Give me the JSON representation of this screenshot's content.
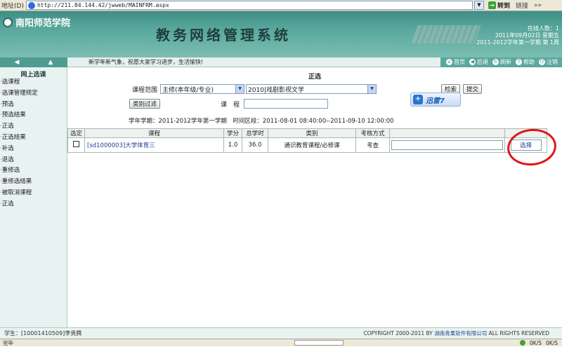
{
  "browser": {
    "address_label": "地址(D)",
    "url": "http://211.84.144.42/jwweb/MAINFRM.aspx",
    "go_label": "转到",
    "links_label": "链接",
    "more_label": "»»",
    "status_left": "完毕",
    "speed1": "0K/S",
    "speed2": "0K/S"
  },
  "header": {
    "school": "南阳师范学院",
    "system_title": "教务网络管理系统",
    "online_label": "在线人数：",
    "online_count": "1",
    "date_line": "2011年09月02日 星期五",
    "term_line": "2011-2012学年第一学期 第 1周"
  },
  "toolbar": {
    "motto": "新学年新气象，祝愿大家学习进步，生活愉快!",
    "links": [
      {
        "label": "首页",
        "icon": "home-icon",
        "glyph": "⌂"
      },
      {
        "label": "后退",
        "icon": "back-icon",
        "glyph": "◀"
      },
      {
        "label": "刷新",
        "icon": "refresh-icon",
        "glyph": "↻"
      },
      {
        "label": "帮助",
        "icon": "help-icon",
        "glyph": "?"
      },
      {
        "label": "注销",
        "icon": "logout-icon",
        "glyph": "⏻"
      }
    ]
  },
  "sidebar": {
    "title": "网上选课",
    "items": [
      "选课程",
      "选课管理规定",
      "预选",
      "预选结果",
      "正选",
      "正选结果",
      "补选",
      "退选",
      "重修选",
      "重修选结果",
      "被取消课程",
      "正选"
    ]
  },
  "main": {
    "title": "正选",
    "scope_label": "课程范围",
    "scope_value": "主修(本年级/专业)",
    "major_value": "2010|戏剧影视文学",
    "search_button": "检索",
    "submit_button": "提交",
    "filter_button": "类别过滤",
    "course_label": "课　程",
    "course_value": "",
    "xunlei_label": "迅雷7",
    "term_info": "学年学期：2011-2012学年第一学期　时间区段：2011-08-01 08:40:00--2011-09-10 12:00:00",
    "table": {
      "headers": [
        "选定",
        "课程",
        "学分",
        "总学时",
        "类别",
        "考核方式",
        ""
      ],
      "rows": [
        {
          "course": "[sd1000003]大学体育三",
          "credit": "1.0",
          "hours": "36.0",
          "category": "通识教育课程/必修课",
          "exam": "考查",
          "note": "",
          "select_label": "选择"
        }
      ]
    }
  },
  "footer": {
    "student": "学生：[10001410509]李贵腾",
    "copyright_prefix": "COPYRIGHT 2000-2011 BY",
    "company": "湖南青果软件有限公司",
    "copyright_suffix": "ALL RIGHTS RESERVED"
  },
  "colors": {
    "header_teal": "#5aa89e",
    "annotation_red": "#e0161a"
  }
}
